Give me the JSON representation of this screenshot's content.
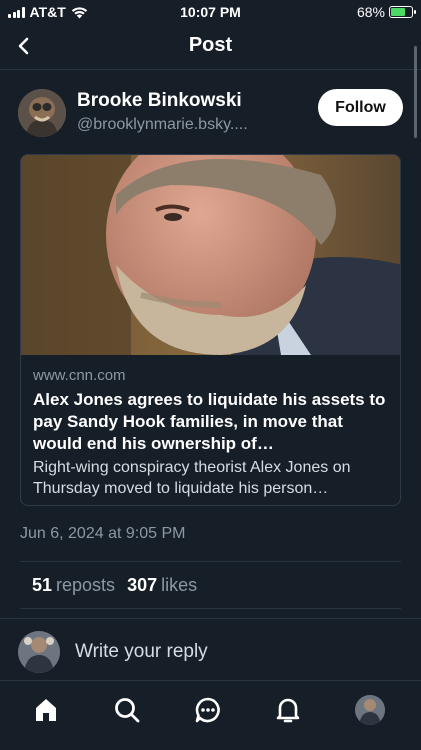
{
  "status_bar": {
    "carrier": "AT&T",
    "time": "10:07 PM",
    "battery": "68%",
    "battery_level": 0.68
  },
  "header": {
    "title": "Post",
    "back_icon": "chevron-left-icon"
  },
  "author": {
    "name": "Brooke Binkowski",
    "handle": "@brooklynmarie.bsky....",
    "follow_label": "Follow"
  },
  "link_card": {
    "domain": "www.cnn.com",
    "title": "Alex Jones agrees to liquidate his assets to pay Sandy Hook families, in move that would end his ownership of…",
    "description": "Right-wing conspiracy theorist Alex Jones on Thursday moved to liquidate his person…"
  },
  "post": {
    "timestamp": "Jun 6, 2024 at 9:05 PM"
  },
  "stats": {
    "reposts_count": "51",
    "reposts_label": "reposts",
    "likes_count": "307",
    "likes_label": "likes"
  },
  "reply": {
    "placeholder": "Write your reply"
  },
  "tabbar": {
    "items": [
      "home-icon",
      "search-icon",
      "chat-icon",
      "bell-icon",
      "profile-avatar"
    ]
  },
  "colors": {
    "background": "#161e27",
    "muted_text": "#8d98a5",
    "border": "#2a3440",
    "battery_fill": "#4cd964"
  }
}
